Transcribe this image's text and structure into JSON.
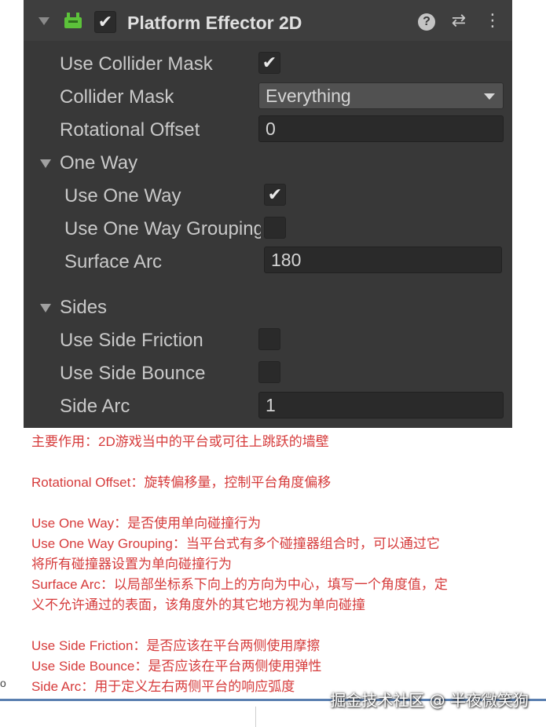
{
  "component": {
    "title": "Platform Effector 2D",
    "enabled_check": "✔",
    "help_icon": "?",
    "presets_icon": "⇄",
    "menu_icon": "⋮"
  },
  "fields": {
    "use_collider_mask": {
      "label": "Use Collider Mask",
      "checked": true,
      "mark": "✔"
    },
    "collider_mask": {
      "label": "Collider Mask",
      "value": "Everything"
    },
    "rotational_offset": {
      "label": "Rotational Offset",
      "value": "0"
    }
  },
  "one_way": {
    "header": "One Way",
    "use_one_way": {
      "label": "Use One Way",
      "checked": true,
      "mark": "✔"
    },
    "use_one_way_grouping": {
      "label": "Use One Way Grouping",
      "checked": false
    },
    "surface_arc": {
      "label": "Surface Arc",
      "value": "180"
    }
  },
  "sides": {
    "header": "Sides",
    "use_side_friction": {
      "label": "Use Side Friction",
      "checked": false
    },
    "use_side_bounce": {
      "label": "Use Side Bounce",
      "checked": false
    },
    "side_arc": {
      "label": "Side Arc",
      "value": "1"
    }
  },
  "notes": {
    "line1": "主要作用：2D游戏当中的平台或可往上跳跃的墙壁",
    "line2": "Rotational Offset：旋转偏移量，控制平台角度偏移",
    "line3": "Use One Way：是否使用单向碰撞行为",
    "line4": "Use One Way Grouping：当平台式有多个碰撞器组合时，可以通过它",
    "line5": "将所有碰撞器设置为单向碰撞行为",
    "line6": "Surface Arc：以局部坐标系下向上的方向为中心，填写一个角度值，定",
    "line7": "义不允许通过的表面，该角度外的其它地方视为单向碰撞",
    "line8": "Use Side Friction：是否应该在平台两侧使用摩擦",
    "line9": "Use Side Bounce：是否应该在平台两侧使用弹性",
    "line10": "Side Arc：用于定义左右两侧平台的响应弧度"
  },
  "left_mark": "o",
  "watermark": "掘金技术社区 @ 半夜微笑狗",
  "colors": {
    "panel_bg": "#383838",
    "header_bg": "#3e3e3e",
    "field_bg": "#2a2a2a",
    "note_text": "#d63b3b",
    "component_icon": "#5cc23a"
  },
  "icons": [
    "fold-arrow-icon",
    "platform-effector-icon",
    "help-icon",
    "presets-icon",
    "kebab-menu-icon",
    "dropdown-arrow-icon"
  ]
}
